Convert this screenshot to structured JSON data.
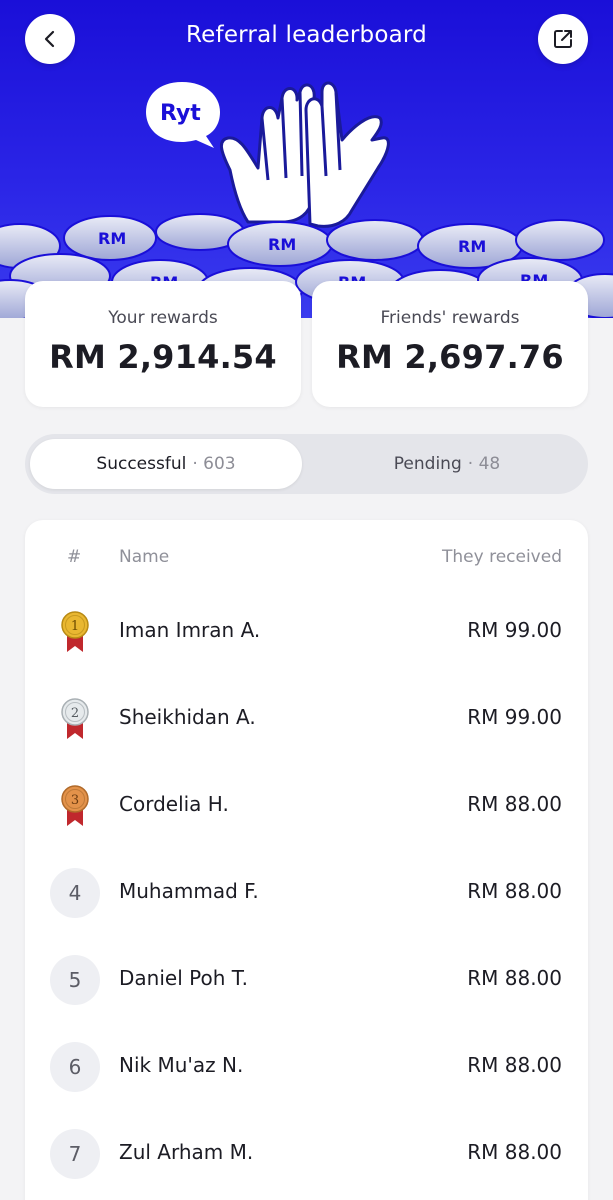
{
  "header": {
    "title": "Referral leaderboard",
    "back_icon": "chevron-left-icon",
    "share_icon": "external-share-icon",
    "brand_bubble": "Ryt",
    "coin_text": "RM",
    "background_color": "#1a0fd8"
  },
  "rewards": {
    "yours": {
      "label": "Your rewards",
      "value": "RM 2,914.54"
    },
    "friends": {
      "label": "Friends' rewards",
      "value": "RM 2,697.76"
    }
  },
  "tabs": [
    {
      "label": "Successful",
      "separator": "·",
      "count": "603",
      "selected": true
    },
    {
      "label": "Pending",
      "separator": "·",
      "count": "48",
      "selected": false
    }
  ],
  "leaderboard": {
    "columns": {
      "rank": "#",
      "name": "Name",
      "received": "They received"
    },
    "rows": [
      {
        "rank": "1",
        "medal": "gold",
        "name": "Iman Imran A.",
        "amount": "RM 99.00"
      },
      {
        "rank": "2",
        "medal": "silver",
        "name": "Sheikhidan A.",
        "amount": "RM 99.00"
      },
      {
        "rank": "3",
        "medal": "bronze",
        "name": "Cordelia H.",
        "amount": "RM 88.00"
      },
      {
        "rank": "4",
        "medal": "",
        "name": "Muhammad F.",
        "amount": "RM 88.00"
      },
      {
        "rank": "5",
        "medal": "",
        "name": "Daniel Poh T.",
        "amount": "RM 88.00"
      },
      {
        "rank": "6",
        "medal": "",
        "name": "Nik Mu'az N.",
        "amount": "RM 88.00"
      },
      {
        "rank": "7",
        "medal": "",
        "name": "Zul Arham M.",
        "amount": "RM 88.00"
      }
    ]
  },
  "colors": {
    "gold": "#e9b731",
    "silver": "#d9dde0",
    "bronze": "#e3924a",
    "ribbon": "#c0282d"
  }
}
